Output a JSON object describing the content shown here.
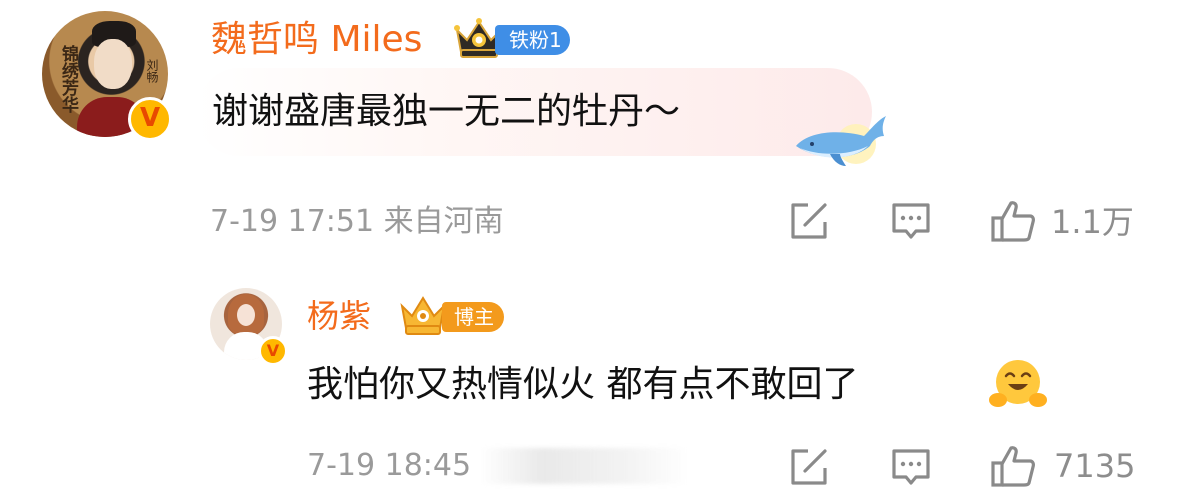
{
  "comment": {
    "author": "魏哲鸣 Miles",
    "fan_badge": "铁粉1",
    "text": "谢谢盛唐最独一无二的牡丹～",
    "time": "7-19 17:51",
    "location": "来自河南",
    "likes": "1.1万",
    "avatar_caption": "锦绣芳华",
    "avatar_caption2": "刘畅",
    "verified_mark": "V"
  },
  "reply": {
    "author": "杨紫",
    "role_badge": "博主",
    "text": "我怕你又热情似火 都有点不敢回了",
    "time": "7-19 18:45",
    "likes": "7135",
    "verified_mark": "V"
  },
  "icons": {
    "comment_action": "edit-square-icon",
    "reply_action": "message-dots-icon",
    "like_action": "thumbs-up-icon",
    "sticker": "whale-sticker-icon",
    "emoji": "hugging-face-emoji"
  },
  "colors": {
    "name": "#f36b1c",
    "fan_badge": "#3f8ee6",
    "blogger_badge": "#f39a1c",
    "meta": "#9a9a9a",
    "verified": "#ffb800"
  }
}
